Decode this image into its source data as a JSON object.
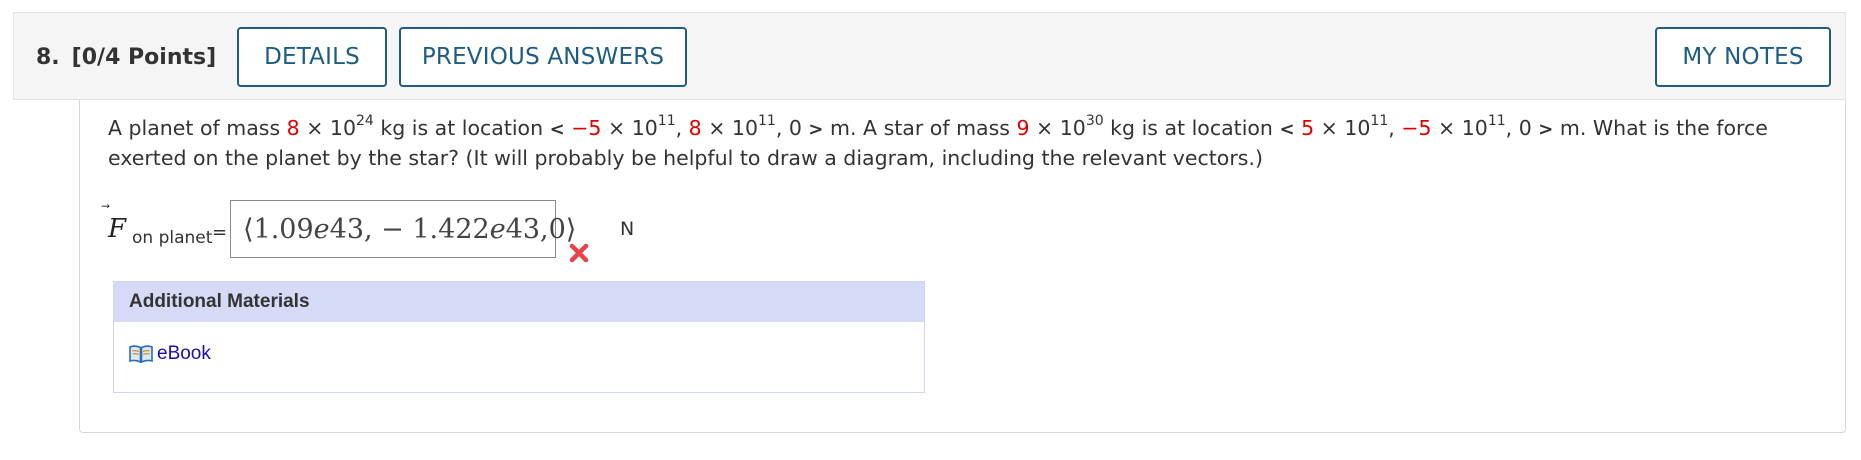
{
  "question": {
    "number": "8.",
    "points": "[0/4 Points]"
  },
  "buttons": {
    "details": "DETAILS",
    "previous_answers": "PREVIOUS ANSWERS",
    "my_notes": "MY NOTES"
  },
  "prompt": {
    "t1": "A planet of mass ",
    "planet_mass_coeff": "8",
    "t2": " × 10",
    "planet_mass_exp": "24",
    "t3": " kg is at location ",
    "lt": "<",
    "planet_x_coeff": "−5",
    "t4": " × 10",
    "planet_x_exp": "11",
    "t5": ", ",
    "planet_y_coeff": "8",
    "t6": " × 10",
    "planet_y_exp": "11",
    "t7": ", 0 ",
    "gt": ">",
    "t8": " m. A star of mass ",
    "star_mass_coeff": "9",
    "t9": " × 10",
    "star_mass_exp": "30",
    "t10": " kg is at location ",
    "star_x_coeff": "5",
    "t11": " × 10",
    "star_x_exp": "11",
    "t12": ", ",
    "star_y_coeff": "−5",
    "t13": " × 10",
    "star_y_exp": "11",
    "t14": ", 0 ",
    "t15": " m. What is the force exerted on the planet by the star? (It will probably be helpful to draw a diagram, including the relevant vectors.)"
  },
  "answer": {
    "var_symbol": "F",
    "var_arrow": "⃗",
    "var_subscript": "on planet",
    "equals": "=",
    "open_bracket": "⟨",
    "v1": "1.09",
    "e1": "e",
    "v1b": "43, − 1.422",
    "e2": "e",
    "v2b": "43,0",
    "close_bracket": "⟩",
    "unit": "N",
    "status": "incorrect"
  },
  "materials": {
    "heading": "Additional Materials",
    "ebook_label": "eBook"
  },
  "colors": {
    "accent": "#1e5c82",
    "highlight": "#e00000",
    "wrong": "#e8424b",
    "materials_header": "#d5dbf6",
    "link": "#1a0dab"
  },
  "icons": [
    "close-icon",
    "book-icon"
  ]
}
